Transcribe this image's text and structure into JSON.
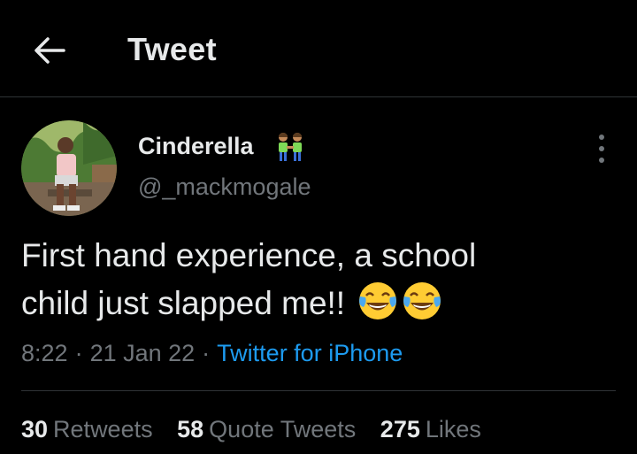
{
  "header": {
    "title": "Tweet",
    "back_icon": "arrow-left-icon"
  },
  "author": {
    "display_name": "Cinderella",
    "name_emoji": "people-holding-hands-emoji",
    "handle": "@_mackmogale",
    "avatar_icon": "user-avatar-photo"
  },
  "more_icon": "vertical-ellipsis-icon",
  "tweet": {
    "text_line1": "First hand experience, a school",
    "text_line2": "child just slapped me!!",
    "emojis": [
      "face-with-tears-of-joy-emoji",
      "face-with-tears-of-joy-emoji"
    ]
  },
  "meta": {
    "time": "8:22",
    "separator": "·",
    "date": "21 Jan 22",
    "source": "Twitter for iPhone"
  },
  "stats": {
    "retweets_count": "30",
    "retweets_label": "Retweets",
    "quotes_count": "58",
    "quotes_label": "Quote Tweets",
    "likes_count": "275",
    "likes_label": "Likes"
  },
  "colors": {
    "background": "#000000",
    "text_primary": "#e7e9ea",
    "text_secondary": "#71767b",
    "link": "#1d9bf0",
    "divider": "#2f3336"
  }
}
